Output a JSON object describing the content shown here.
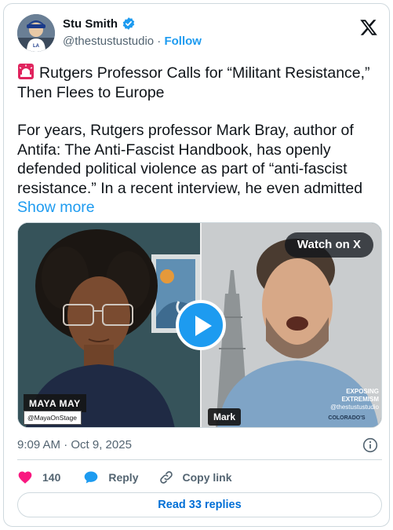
{
  "author": {
    "display_name": "Stu Smith",
    "handle": "@thestustustudio",
    "separator": " · ",
    "follow_label": "Follow"
  },
  "tweet": {
    "title": "Rutgers Professor Calls for “Militant Resistance,” Then Flees to Europe",
    "body": "For years, Rutgers professor Mark Bray, author of Antifa: The Anti-Fascist Handbook, has openly defended political violence as part of “anti-fascist resistance.” In a recent interview, he even admitted",
    "show_more": "Show more"
  },
  "media": {
    "left_name_tag": "MAYA MAY",
    "left_handle_tag": "@MayaOnStage",
    "right_name_tag": "Mark",
    "watch_label": "Watch on X",
    "watermark_title": "EXPOSING EXTREMISM",
    "watermark_handle": "@thestustustudio",
    "shirt_text": "COLORADO'S"
  },
  "meta": {
    "timestamp": "9:09 AM · Oct 9, 2025"
  },
  "actions": {
    "like_count": "140",
    "reply_label": "Reply",
    "copy_label": "Copy link"
  },
  "footer": {
    "read_replies": "Read 33 replies"
  },
  "colors": {
    "accent": "#1d9bf0",
    "like": "#f91880",
    "link": "#006fd6",
    "muted": "#536471"
  },
  "icons": [
    "verified-badge-icon",
    "x-logo-icon",
    "siren-icon",
    "play-icon",
    "info-icon",
    "heart-icon",
    "reply-bubble-icon",
    "link-icon"
  ]
}
